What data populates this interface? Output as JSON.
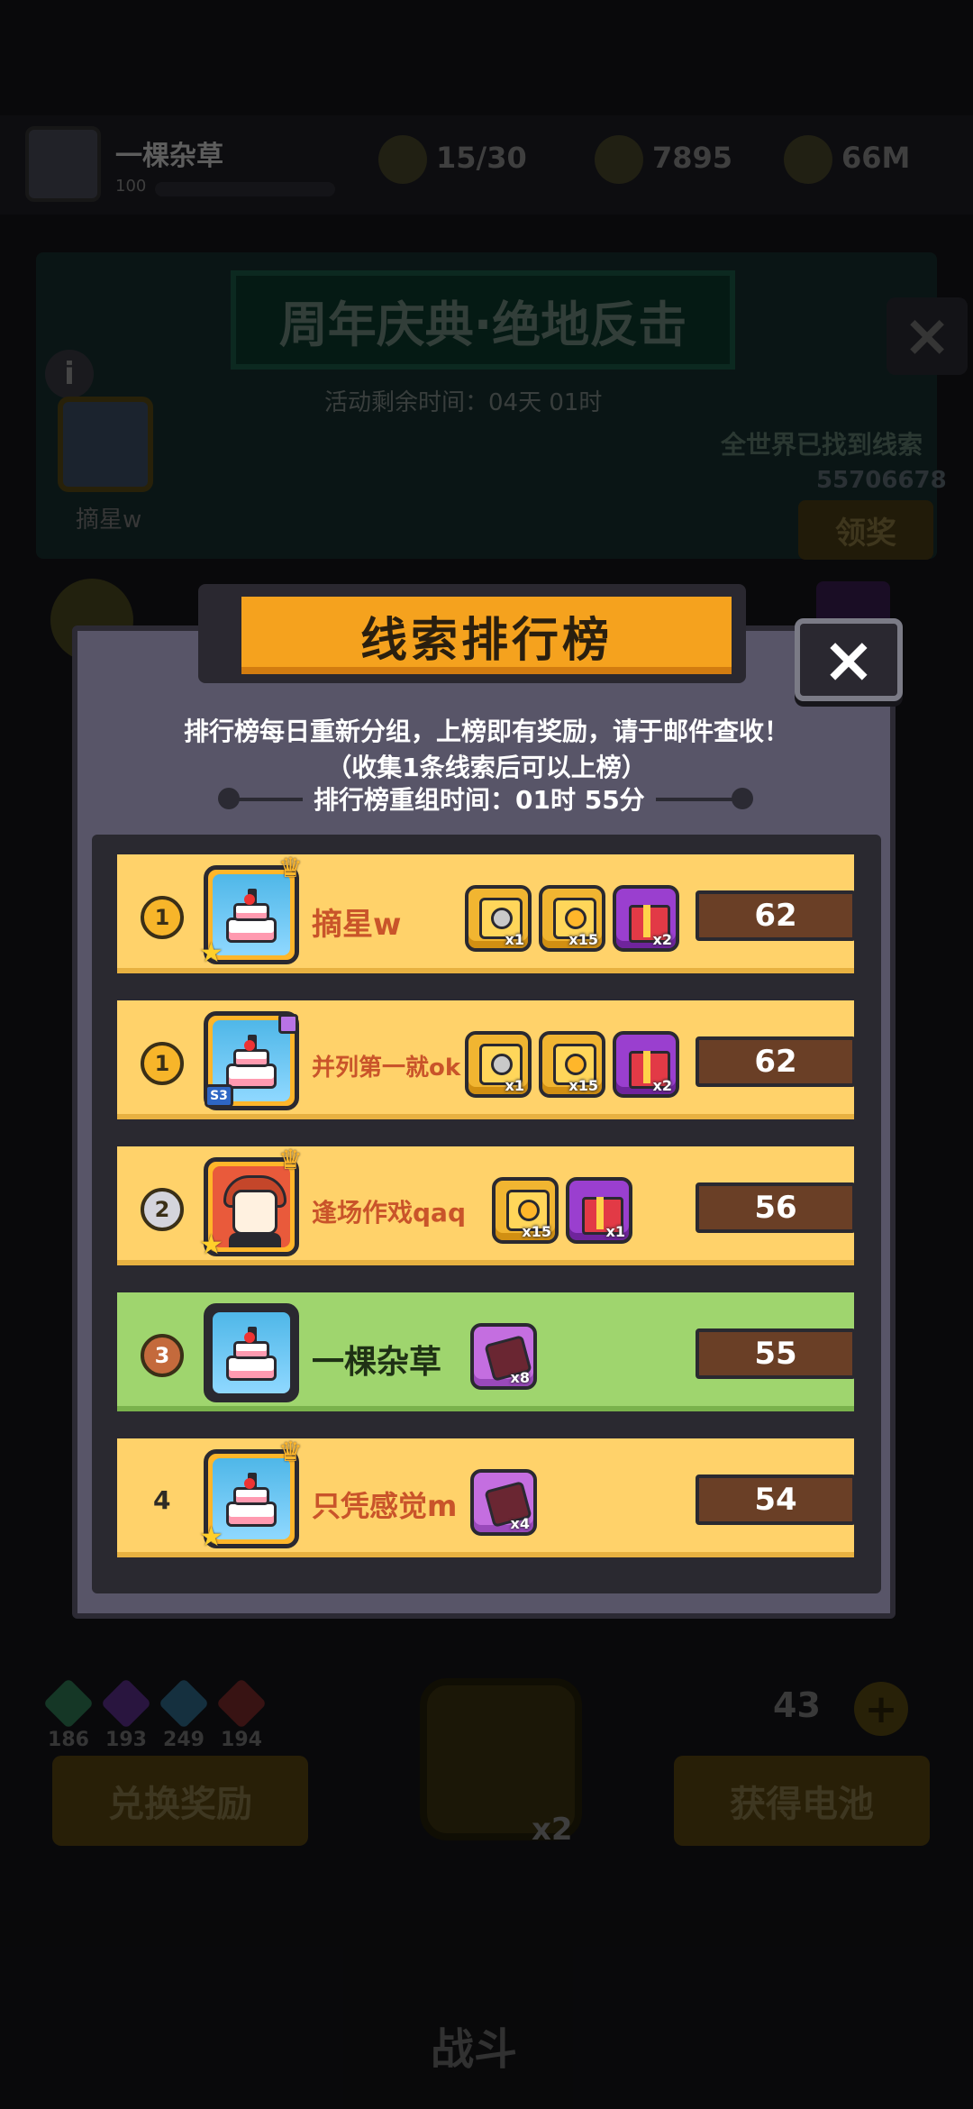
{
  "background": {
    "player": {
      "name": "一棵杂草",
      "level": "100"
    },
    "resources": [
      {
        "icon": "energy-icon",
        "value": "15/30"
      },
      {
        "icon": "power-icon",
        "value": "7895"
      },
      {
        "icon": "coin-icon",
        "value": "66M"
      }
    ],
    "event": {
      "title": "周年庆典·绝地反击",
      "time_remaining": "活动剩余时间：04天 01时",
      "world_found_label": "全世界已找到线索",
      "world_found_count": "55706678",
      "claim_label": "领奖",
      "left_player_name": "摘星w"
    },
    "gems": [
      {
        "color": "#2f7b55",
        "count": "186"
      },
      {
        "color": "#5b2f8c",
        "count": "193"
      },
      {
        "color": "#2f6c8c",
        "count": "249"
      },
      {
        "color": "#7c2a2a",
        "count": "194"
      }
    ],
    "exchange_label": "兑换奖励",
    "battery_label": "获得电池",
    "battery_count": "43",
    "unlock_multiplier": "x2",
    "battle_label": "战斗"
  },
  "modal": {
    "title": "线索排行榜",
    "desc_line1": "排行榜每日重新分组，上榜即有奖励，请于邮件查收！",
    "desc_line2": "（收集1条线索后可以上榜）",
    "regroup_text": "排行榜重组时间：01时 55分",
    "close_icon": "×",
    "rows": [
      {
        "rank": "1",
        "rank_style": "gold",
        "name": "摘星w",
        "avatar": "cake",
        "score": "62",
        "rewards": [
          {
            "type": "silver-chest",
            "qty": "x1"
          },
          {
            "type": "gold-chest",
            "qty": "x15"
          },
          {
            "type": "gift-box",
            "qty": "x2"
          }
        ]
      },
      {
        "rank": "1",
        "rank_style": "gold",
        "name": "并列第一就ok",
        "avatar": "cake",
        "avatar_badge": "S3",
        "score": "62",
        "rewards": [
          {
            "type": "silver-chest",
            "qty": "x1"
          },
          {
            "type": "gold-chest",
            "qty": "x15"
          },
          {
            "type": "gift-box",
            "qty": "x2"
          }
        ]
      },
      {
        "rank": "2",
        "rank_style": "silver",
        "name": "逢场作戏qaq",
        "avatar": "girl",
        "score": "56",
        "rewards": [
          {
            "type": "gold-chest",
            "qty": "x15"
          },
          {
            "type": "gift-box",
            "qty": "x1"
          }
        ]
      },
      {
        "rank": "3",
        "rank_style": "bronze",
        "name": "一棵杂草",
        "avatar": "cake",
        "score": "55",
        "self": true,
        "rewards": [
          {
            "type": "puzzle-piece",
            "qty": "x8"
          }
        ]
      },
      {
        "rank": "4",
        "rank_style": "plain",
        "name": "只凭感觉m",
        "avatar": "cake",
        "score": "54",
        "rewards": [
          {
            "type": "puzzle-piece",
            "qty": "x4"
          }
        ]
      }
    ]
  }
}
